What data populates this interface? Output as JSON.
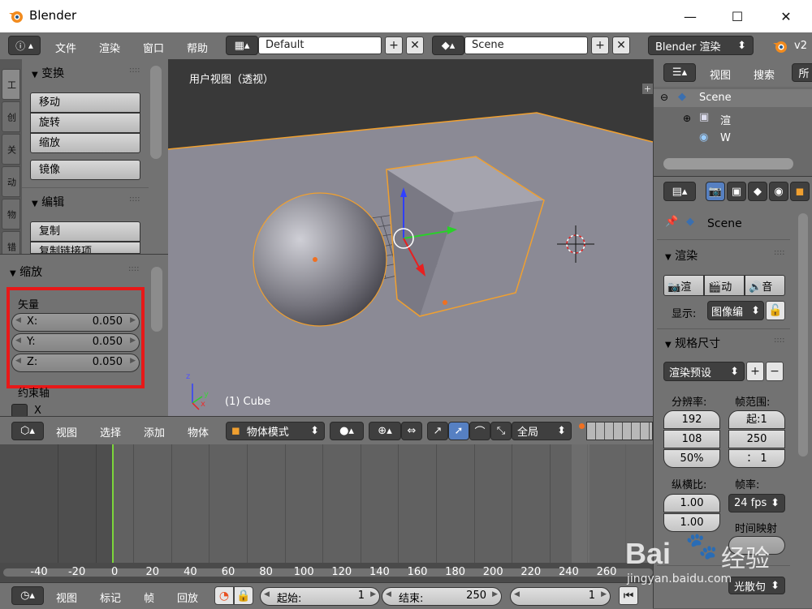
{
  "window": {
    "title": "Blender",
    "minimize": "—",
    "maximize": "☐",
    "close": "✕"
  },
  "topbar": {
    "menus": [
      "文件",
      "渲染",
      "窗口",
      "帮助"
    ],
    "layout": "Default",
    "scene": "Scene",
    "engine": "Blender 渲染",
    "version": "v2"
  },
  "tool_tabs": [
    "工",
    "创",
    "关",
    "动",
    "物",
    "错"
  ],
  "toolshelf": {
    "transform_header": "变换",
    "transform_buttons": [
      "移动",
      "旋转",
      "缩放"
    ],
    "mirror_button": "镜像",
    "edit_header": "编辑",
    "edit_buttons": [
      "复制",
      "复制链接项"
    ]
  },
  "redo_panel": {
    "header": "缩放",
    "vector_label": "矢量",
    "fields": [
      {
        "label": "X:",
        "value": "0.050"
      },
      {
        "label": "Y:",
        "value": "0.050"
      },
      {
        "label": "Z:",
        "value": "0.050"
      }
    ],
    "constraint_label": "约束轴",
    "constraint_x": "X"
  },
  "viewport": {
    "view_name": "用户视图（透视）",
    "object_label": "(1) Cube",
    "axis_x": "x",
    "axis_y": "y",
    "axis_z": "z"
  },
  "view_header": {
    "menus": [
      "视图",
      "选择",
      "添加",
      "物体"
    ],
    "mode": "物体模式",
    "orientation": "全局"
  },
  "timeline": {
    "ticks": [
      "-40",
      "-20",
      "0",
      "20",
      "40",
      "60",
      "80",
      "100",
      "120",
      "140",
      "160",
      "180",
      "200",
      "220",
      "240",
      "260"
    ],
    "current_frame_marker": 0
  },
  "bottom_bar": {
    "menus": [
      "视图",
      "标记",
      "帧",
      "回放"
    ],
    "start_label": "起始:",
    "start_value": "1",
    "end_label": "结束:",
    "end_value": "250",
    "current_value": "1"
  },
  "outliner": {
    "header_menus": [
      "视图",
      "搜索"
    ],
    "filter": "所",
    "items": [
      "Scene",
      "渲",
      "W"
    ]
  },
  "properties": {
    "context_scene": "Scene",
    "render_header": "渲染",
    "render_buttons": [
      "渲",
      "动",
      "音"
    ],
    "display_label": "显示:",
    "display_value": "图像编",
    "dimensions_header": "规格尺寸",
    "render_preset": "渲染预设",
    "resolution_label": "分辨率:",
    "res_x": "192",
    "res_y": "108",
    "res_pct": "50%",
    "frame_range_label": "帧范围:",
    "frame_start": "起:1",
    "frame_end": "250",
    "frame_step": "：  1",
    "aspect_label": "纵横比:",
    "aspect_x": "1.00",
    "aspect_y": "1.00",
    "fps_label": "帧率:",
    "fps_value": "24 fps",
    "time_remap_label": "时间映射",
    "aa_preset": "光散句"
  },
  "watermark": {
    "text1": "Bai",
    "text2": "经验",
    "url": "jingyan.baidu.com"
  },
  "colors": {
    "highlight_red": "#e81818",
    "selection_orange": "#f0a030",
    "frame_green": "#7cd63a"
  }
}
